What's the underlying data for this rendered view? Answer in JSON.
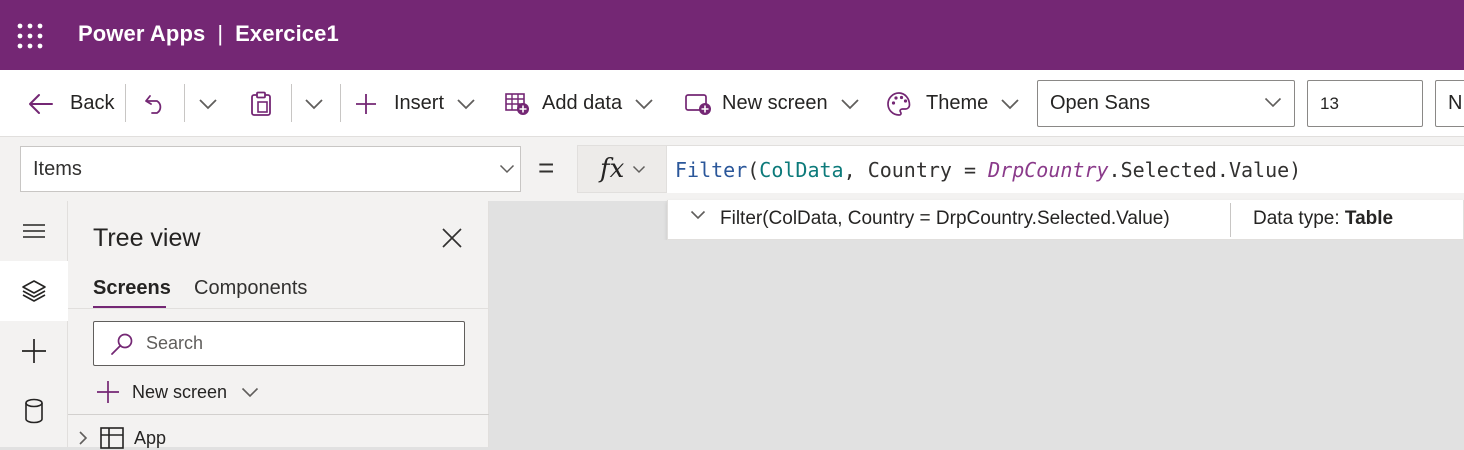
{
  "header": {
    "app_name": "Power Apps",
    "separator": "|",
    "doc_name": "Exercice1",
    "bg_color": "#742774"
  },
  "commandbar": {
    "back_label": "Back",
    "insert_label": "Insert",
    "add_data_label": "Add data",
    "new_screen_label": "New screen",
    "theme_label": "Theme",
    "font_value": "Open Sans",
    "font_size_value": "13",
    "next_field_value": "N"
  },
  "formulabar": {
    "property": "Items",
    "equals": "=",
    "fx": "fx",
    "formula": {
      "fn": "Filter",
      "open": "(",
      "col": "ColData",
      "comma": ", ",
      "field": "Country",
      "op": " = ",
      "ctrl": "DrpCountry",
      "rest": ".Selected.Value)"
    },
    "result_expr": "Filter(ColData, Country = DrpCountry.Selected.Value)",
    "result_type_label": "Data type:",
    "result_type_value": "Table"
  },
  "rail": {
    "items": [
      "hamburger-icon",
      "layers-icon",
      "plus-icon",
      "database-icon"
    ]
  },
  "tree": {
    "title": "Tree view",
    "tabs": [
      {
        "label": "Screens",
        "active": true
      },
      {
        "label": "Components",
        "active": false
      }
    ],
    "search_placeholder": "Search",
    "new_screen_label": "New screen",
    "nodes": [
      {
        "label": "App"
      }
    ]
  },
  "colors": {
    "accent": "#742774",
    "canvas": "#e1e1e1",
    "fn_token": "#2b579a",
    "col_token": "#0c7a7a",
    "ctrl_token": "#8a3a8a"
  }
}
